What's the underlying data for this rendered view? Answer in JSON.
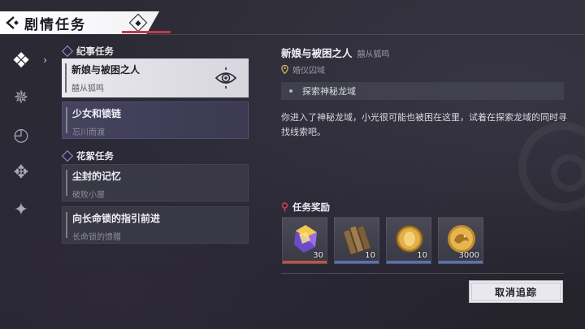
{
  "header": {
    "title": "剧情任务"
  },
  "rail": {
    "items": [
      {
        "icon": "four-diamond-icon",
        "glyph": "❖",
        "active": true
      },
      {
        "icon": "gear-diamond-icon",
        "glyph": "✵",
        "active": false
      },
      {
        "icon": "clock-icon",
        "glyph": "◴",
        "active": false
      },
      {
        "icon": "cross-diamond-icon",
        "glyph": "✥",
        "active": false
      },
      {
        "icon": "star-diamond-icon",
        "glyph": "✦",
        "active": false
      }
    ]
  },
  "categories": {
    "main": "纪事任务",
    "side": "花絮任务"
  },
  "quests": [
    {
      "title": "新娘与被困之人",
      "subtitle": "囍从狐鸣",
      "state": "selected"
    },
    {
      "title": "少女和锁链",
      "subtitle": "忘川而渡",
      "state": "tracked"
    },
    {
      "title": "尘封的记忆",
      "subtitle": "破败小屋",
      "state": "normal"
    },
    {
      "title": "向长命锁的指引前进",
      "subtitle": "长命锁的馈赠",
      "state": "normal"
    }
  ],
  "detail": {
    "title": "新娘与被困之人",
    "giver": "囍从狐鸣",
    "location": "婚仪囚域",
    "objective": "探索神秘龙域",
    "description": "你进入了神秘龙域，小光很可能也被困在这里，试着在探索龙域的同时寻找线索吧。"
  },
  "rewards": {
    "title": "任务奖励",
    "items": [
      {
        "icon": "purple-crystal-icon",
        "count": "30",
        "rarity_color": "#c8503c"
      },
      {
        "icon": "wooden-planks-icon",
        "count": "10",
        "rarity_color": "#5a6fb8"
      },
      {
        "icon": "gold-coin-icon",
        "count": "10",
        "rarity_color": "#5a6fb8"
      },
      {
        "icon": "dragon-coin-icon",
        "count": "3000",
        "rarity_color": "#5a6fb8"
      }
    ]
  },
  "actions": {
    "cancel_tracking": "取消追踪"
  },
  "colors": {
    "accent": "#c23a4a",
    "tracked": "#45435e",
    "selected": "#e9e8ee"
  }
}
